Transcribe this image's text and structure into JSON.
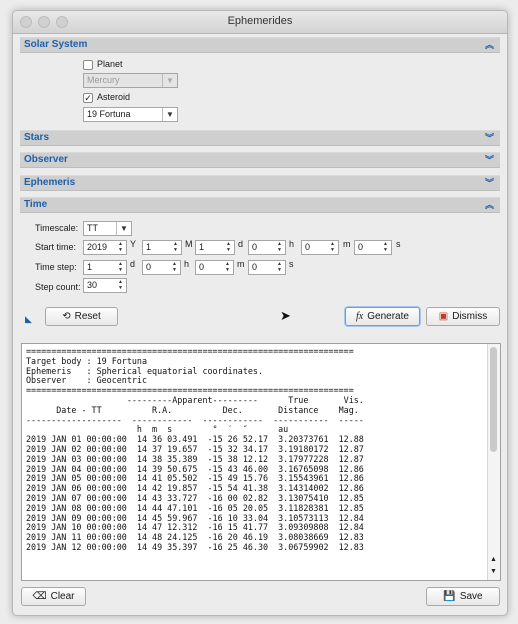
{
  "window": {
    "title": "Ephemerides"
  },
  "sections": {
    "solar_system": "Solar System",
    "stars": "Stars",
    "observer": "Observer",
    "ephemeris": "Ephemeris",
    "time": "Time"
  },
  "solar": {
    "planet_label": "Planet",
    "planet_checked": false,
    "planet_value": "Mercury",
    "asteroid_label": "Asteroid",
    "asteroid_checked": true,
    "asteroid_value": "19 Fortuna"
  },
  "time": {
    "timescale_label": "Timescale:",
    "timescale_value": "TT",
    "start_label": "Start time:",
    "start": {
      "year": "2019",
      "year_unit": "Y",
      "month": "1",
      "month_unit": "M",
      "day": "1",
      "day_unit": "d",
      "hour": "0",
      "hour_unit": "h",
      "minute": "0",
      "minute_unit": "m",
      "second": "0",
      "second_unit": "s"
    },
    "step_label": "Time step:",
    "step": {
      "d": "1",
      "d_unit": "d",
      "h": "0",
      "h_unit": "h",
      "m": "0",
      "m_unit": "m",
      "s": "0",
      "s_unit": "s"
    },
    "count_label": "Step count:",
    "count_value": "30"
  },
  "buttons": {
    "reset": "Reset",
    "generate": "Generate",
    "dismiss": "Dismiss",
    "clear": "Clear",
    "save": "Save"
  },
  "icons": {
    "collapse": "collapse-arrows-icon",
    "expand": "expand-arrows-icon",
    "accent_blue": "#1f5fa8"
  },
  "output": {
    "header_lines": [
      "=================================================================",
      "Target body : 19 Fortuna",
      "Ephemeris   : Spherical equatorial coordinates.",
      "Observer    : Geocentric",
      "=================================================================",
      "                    ---------Apparent---------      True       Vis.",
      "      Date - TT          R.A.          Dec.       Distance    Mag.",
      "-------------------  ------------  ------------  -----------  -----",
      "                      h  m  s        °  ′  ″      au"
    ],
    "rows": [
      "2019 JAN 01 00:00:00  14 36 03.491  -15 26 52.17  3.20373761  12.88",
      "2019 JAN 02 00:00:00  14 37 19.657  -15 32 34.17  3.19180172  12.87",
      "2019 JAN 03 00:00:00  14 38 35.389  -15 38 12.12  3.17977228  12.87",
      "2019 JAN 04 00:00:00  14 39 50.675  -15 43 46.00  3.16765098  12.86",
      "2019 JAN 05 00:00:00  14 41 05.502  -15 49 15.76  3.15543961  12.86",
      "2019 JAN 06 00:00:00  14 42 19.857  -15 54 41.38  3.14314002  12.86",
      "2019 JAN 07 00:00:00  14 43 33.727  -16 00 02.82  3.13075410  12.85",
      "2019 JAN 08 00:00:00  14 44 47.101  -16 05 20.05  3.11828381  12.85",
      "2019 JAN 09 00:00:00  14 45 59.967  -16 10 33.04  3.10573113  12.84",
      "2019 JAN 10 00:00:00  14 47 12.312  -16 15 41.77  3.09309808  12.84",
      "2019 JAN 11 00:00:00  14 48 24.125  -16 20 46.19  3.08038669  12.83",
      "2019 JAN 12 00:00:00  14 49 35.397  -16 25 46.30  3.06759902  12.83"
    ]
  }
}
